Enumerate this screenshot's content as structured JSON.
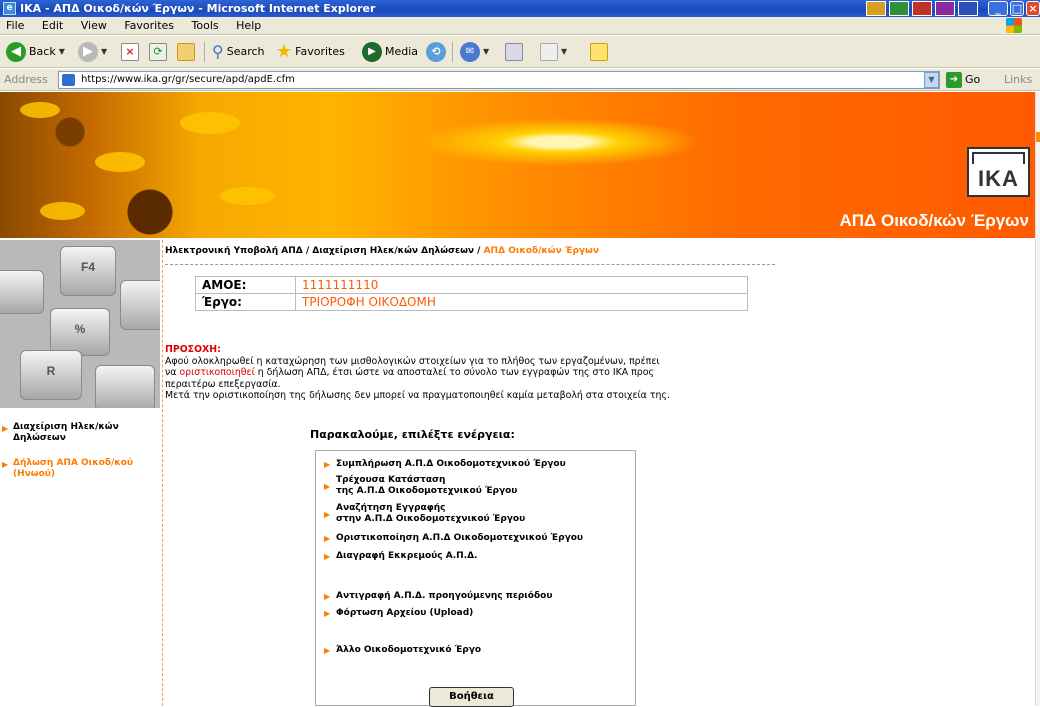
{
  "window": {
    "title": "IKA - ΑΠΔ Οικοδ/κών Έργων - Microsoft Internet Explorer",
    "app_icon": "ie-icon"
  },
  "menu": [
    "File",
    "Edit",
    "View",
    "Favorites",
    "Tools",
    "Help"
  ],
  "toolbar": {
    "back": "Back",
    "search": "Search",
    "favorites": "Favorites",
    "media": "Media"
  },
  "addressbar": {
    "label": "Address",
    "url": "https://www.ika.gr/gr/secure/apd/apdE.cfm",
    "go": "Go",
    "links": "Links"
  },
  "banner": {
    "logo": "IKA",
    "title": "ΑΠΔ Οικοδ/κών Έργων",
    "accent": "#ff7a00"
  },
  "sidebar": {
    "items": [
      {
        "label": "Διαχείριση Ηλεκ/κών Δηλώσεων",
        "active": false
      },
      {
        "label": "Δήλωση ΑΠΑ Οικοδ/κού (Ηνωού)",
        "active": true
      }
    ]
  },
  "breadcrumb": {
    "part1": "Ηλεκτρονική Υποβολή ΑΠΔ",
    "part2": "Διαχείριση Ηλεκ/κών Δηλώσεων",
    "current": "ΑΠΔ Οικοδ/κών Έργων",
    "sep": " / "
  },
  "info": {
    "amoe_label": "ΑΜΟΕ:",
    "amoe_value": "1111111110",
    "ergo_label": "Έργο:",
    "ergo_value": "ΤΡΙΟΡΟΦΗ ΟΙΚΟΔΟΜΗ"
  },
  "notice": {
    "warning": "ΠΡΟΣΟΧΗ:",
    "line1": "Αφού ολοκληρωθεί η καταχώρηση των μισθολογικών στοιχείων για το πλήθος των εργαζομένων, πρέπει",
    "line2_pre": "να ",
    "line2_link": "οριστικοποιηθεί",
    "line2_post": " η δήλωση ΑΠΔ, έτσι ώστε να αποσταλεί το σύνολο των εγγραφών της στο ΙΚΑ προς",
    "line3": "περαιτέρω επεξεργασία.",
    "line4": "Μετά την οριστικοποίηση της δήλωσης δεν μπορεί να πραγματοποιηθεί καμία μεταβολή στα στοιχεία της."
  },
  "actions": {
    "title": "Παρακαλούμε, επιλέξτε ενέργεια:",
    "items": [
      {
        "line1": "Συμπλήρωση Α.Π.Δ Οικοδομοτεχνικού Έργου",
        "line2": ""
      },
      {
        "line1": "Τρέχουσα Κατάσταση",
        "line2": "της Α.Π.Δ Οικοδομοτεχνικού Έργου"
      },
      {
        "line1": "Αναζήτηση Εγγραφής",
        "line2": "στην Α.Π.Δ Οικοδομοτεχνικού Έργου"
      },
      {
        "line1": "Οριστικοποίηση Α.Π.Δ Οικοδομοτεχνικού Έργου",
        "line2": ""
      },
      {
        "line1": "Διαγραφή Εκκρεμούς Α.Π.Δ.",
        "line2": ""
      },
      {
        "line1": "Αντιγραφή Α.Π.Δ. προηγούμενης περιόδου",
        "line2": ""
      },
      {
        "line1": "Φόρτωση Αρχείου (Upload)",
        "line2": ""
      },
      {
        "line1": "Άλλο Οικοδομοτεχνικό Έργο",
        "line2": ""
      }
    ],
    "help": "Βοήθεια"
  }
}
